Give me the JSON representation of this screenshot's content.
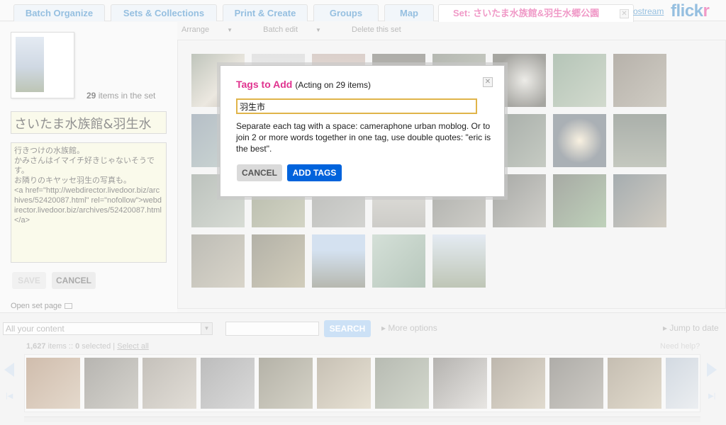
{
  "tabs": [
    {
      "label": "Batch Organize"
    },
    {
      "label": "Sets & Collections"
    },
    {
      "label": "Print & Create"
    },
    {
      "label": "Groups"
    },
    {
      "label": "Map"
    },
    {
      "label": "Set: さいたま水族館&羽生水郷公園"
    }
  ],
  "header": {
    "photostream_link": "ostream",
    "logo_part1": "flick",
    "logo_part2": "r"
  },
  "set_panel": {
    "count": "29",
    "count_suffix": " items in the set",
    "title_value": "さいたま水族館&羽生水",
    "description_value": "行きつけの水族館。\nかみさんはイマイチ好きじゃないそうです。\nお隣りのキヤッセ羽生の写真も。\n<a href=\"http://webdirector.livedoor.biz/archives/52420087.html\" rel=\"nofollow\">webdirector.livedoor.biz/archives/52420087.html</a>",
    "save_label": "SAVE",
    "cancel_label": "CANCEL",
    "open_set_label": "Open set page"
  },
  "submenu": {
    "arrange": "Arrange",
    "batch_edit": "Batch edit",
    "delete_set": "Delete this set"
  },
  "organizer": {
    "content_select": "All your content",
    "search_label": "SEARCH",
    "more_options": "More options",
    "jump_to_date": "Jump to date",
    "items_count": "1,627",
    "items_text": " items :: ",
    "selected_count": "0",
    "selected_text": " selected | ",
    "select_all": "Select all",
    "need_help": "Need help?"
  },
  "dialog": {
    "title": "Tags to Add",
    "subtitle": "(Acting on 29 items)",
    "tag_value": "羽生市",
    "help_text": "Separate each tag with a space: cameraphone urban moblog. Or to join 2 or more words together in one tag, use double quotes: \"eric is the best\".",
    "cancel_label": "CANCEL",
    "add_label": "ADD TAGS"
  },
  "colors": {
    "link_blue": "#2a7fc1",
    "flickr_pink": "#e0338f",
    "primary_button": "#0063dc"
  }
}
